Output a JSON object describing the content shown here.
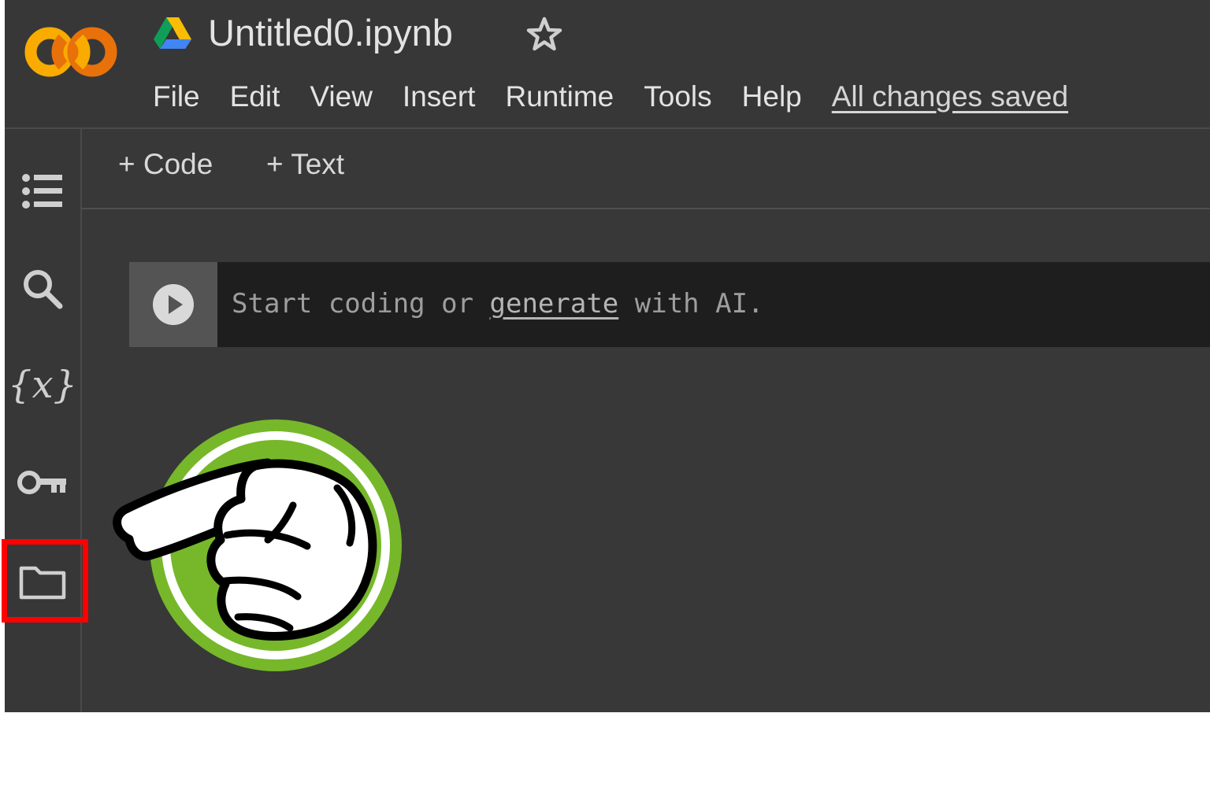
{
  "header": {
    "title": "Untitled0.ipynb",
    "logo_text": "CO",
    "menu": [
      "File",
      "Edit",
      "View",
      "Insert",
      "Runtime",
      "Tools",
      "Help"
    ],
    "save_status": "All changes saved"
  },
  "sidebar": {
    "items": [
      {
        "icon": "table-of-contents-icon"
      },
      {
        "icon": "search-icon"
      },
      {
        "icon": "variables-icon",
        "label": "{x}"
      },
      {
        "icon": "key-icon"
      },
      {
        "icon": "folder-icon",
        "highlighted": true
      }
    ]
  },
  "toolbar": {
    "add_code": "+ Code",
    "add_text": "+ Text"
  },
  "cell": {
    "placeholder_prefix": "Start coding or ",
    "placeholder_link": "generate",
    "placeholder_suffix": " with AI."
  },
  "colors": {
    "background": "#383838",
    "cell_background": "#1e1e1e",
    "highlight": "#ff0000",
    "pointer_badge": "#76b82a"
  }
}
